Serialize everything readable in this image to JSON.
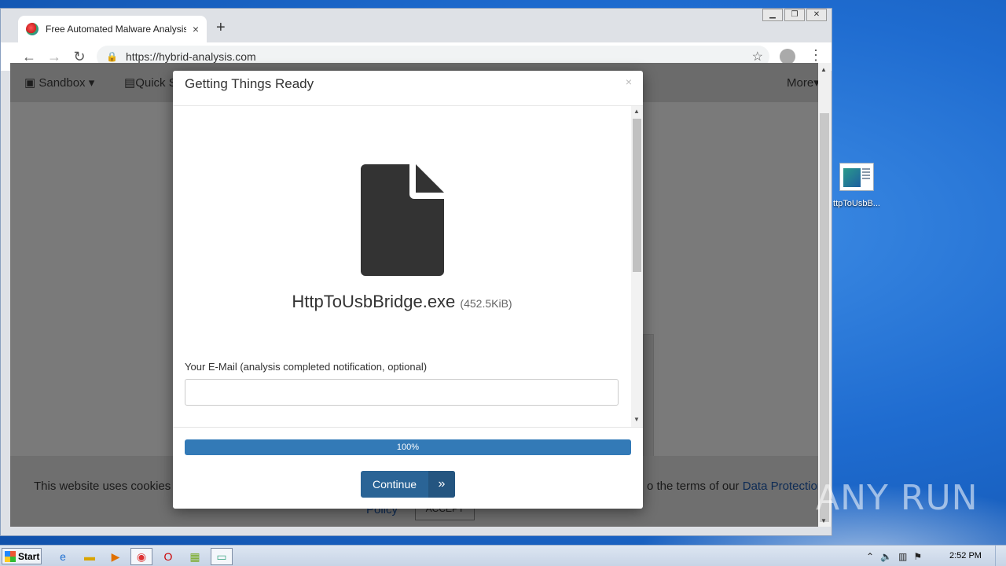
{
  "browser": {
    "tab_title": "Free Automated Malware Analysis S",
    "url": "https://hybrid-analysis.com",
    "new_tab": "+",
    "close_tab": "×"
  },
  "page": {
    "nav": {
      "sandbox": "Sandbox",
      "quick": "Quick S",
      "more": "More"
    },
    "cookie": {
      "text_left": "This website uses cookies to",
      "text_right": "o the terms of our",
      "link": "Data Protection",
      "policy": "Policy",
      "accept": "ACCEPT"
    }
  },
  "modal": {
    "title": "Getting Things Ready",
    "close": "×",
    "file_name": "HttpToUsbBridge.exe",
    "file_size": "(452.5KiB)",
    "email_label": "Your E-Mail (analysis completed notification, optional)",
    "email_value": "",
    "progress_percent": 100,
    "progress_label": "100%",
    "continue_label": "Continue",
    "continue_arrow": "»"
  },
  "desktop": {
    "icon_label": "ttpToUsbB..."
  },
  "watermark": "ANY RUN",
  "taskbar": {
    "start": "Start",
    "clock": "2:52 PM"
  }
}
